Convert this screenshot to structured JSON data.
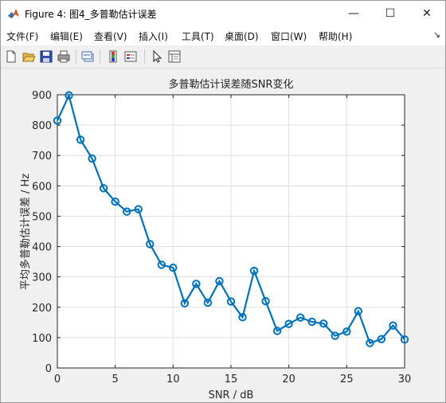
{
  "window": {
    "title": "Figure 4: 图4_多普勒估计误差",
    "controls": {
      "minimize": "—",
      "maximize": "☐",
      "close": "✕"
    }
  },
  "menubar": {
    "items": [
      "文件(F)",
      "编辑(E)",
      "查看(V)",
      "插入(I)",
      "工具(T)",
      "桌面(D)",
      "窗口(W)",
      "帮助(H)"
    ],
    "overflow_arrow": "↘"
  },
  "toolbar": {
    "buttons": [
      "new-figure-icon",
      "open-file-icon",
      "save-icon",
      "print-icon",
      "link-icon",
      "insert-colorbar-icon",
      "insert-legend-icon",
      "pointer-icon",
      "property-inspector-icon"
    ]
  },
  "colors": {
    "line": "#0072BD",
    "axes": "#262626",
    "grid": "#dfdfdf",
    "plot_bg": "#ffffff"
  },
  "chart_data": {
    "type": "line",
    "title": "多普勒估计误差随SNR变化",
    "xlabel": "SNR / dB",
    "ylabel": "平均多普勒估计误差 / Hz",
    "xlim": [
      0,
      30
    ],
    "ylim": [
      0,
      900
    ],
    "xticks": [
      0,
      5,
      10,
      15,
      20,
      25,
      30
    ],
    "yticks": [
      0,
      100,
      200,
      300,
      400,
      500,
      600,
      700,
      800,
      900
    ],
    "grid": true,
    "marker": "circle",
    "x": [
      0,
      1,
      2,
      3,
      4,
      5,
      6,
      7,
      8,
      9,
      10,
      11,
      12,
      13,
      14,
      15,
      16,
      17,
      18,
      19,
      20,
      21,
      22,
      23,
      24,
      25,
      26,
      27,
      28,
      29,
      30
    ],
    "y": [
      815,
      898,
      752,
      690,
      592,
      548,
      515,
      523,
      408,
      340,
      330,
      213,
      277,
      215,
      286,
      219,
      167,
      320,
      220,
      122,
      145,
      166,
      152,
      146,
      106,
      120,
      187,
      82,
      95,
      140,
      94
    ]
  }
}
